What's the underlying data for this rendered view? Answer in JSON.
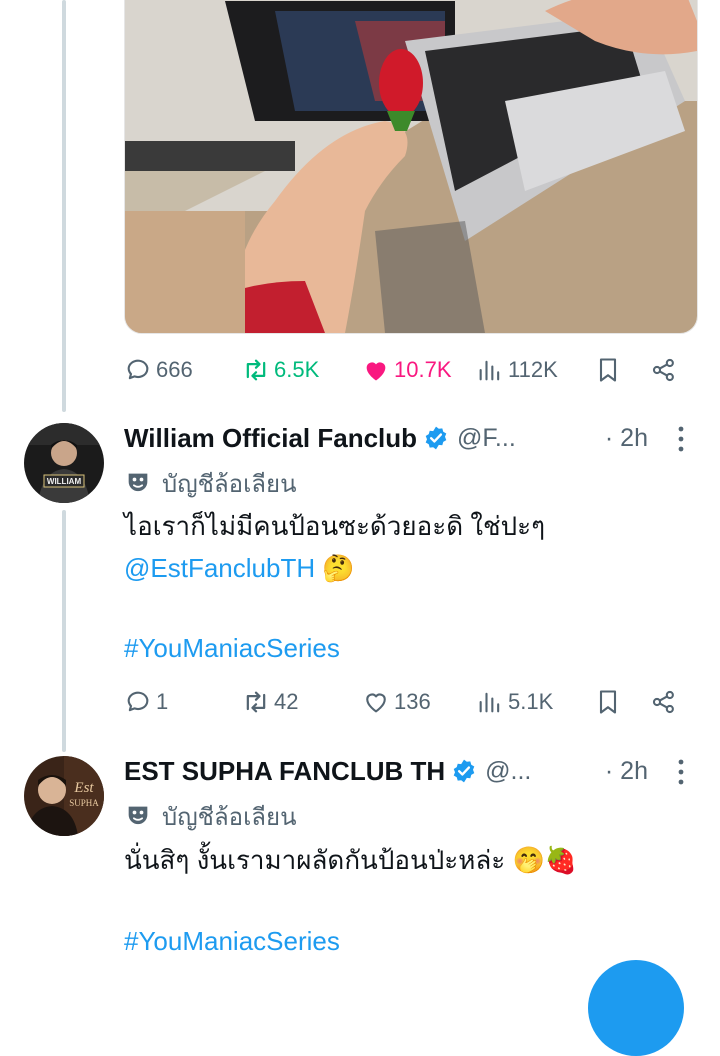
{
  "first_tweet": {
    "actions": {
      "replies": "666",
      "retweets": "6.5K",
      "likes": "10.7K",
      "views": "112K"
    }
  },
  "tweets": [
    {
      "name": "William Official Fanclub",
      "handle": "@F...",
      "time": "· 2h",
      "parody_label": "บัญชีล้อเลียน",
      "line1": "ไอเราก็ไม่มีคนป้อนซะด้วยอะดิ ใช่ปะๆ",
      "mention": "@EstFanclubTH",
      "mention_emoji": "🤔",
      "hashtag": "#YouManiacSeries",
      "actions": {
        "replies": "1",
        "retweets": "42",
        "likes": "136",
        "views": "5.1K"
      },
      "avatar_text": "WILLIAM"
    },
    {
      "name": "EST SUPHA FANCLUB TH",
      "handle": "@...",
      "time": "· 2h",
      "parody_label": "บัญชีล้อเลียน",
      "line1": "นั่นสิๆ งั้นเรามาผลัดกันป้อนป่ะหล่ะ",
      "line1_emoji": "🤭🍓",
      "hashtag": "#YouManiacSeries",
      "avatar_text": "Est",
      "avatar_subtext": "SUPHA"
    }
  ],
  "colors": {
    "accent": "#1d9bf0",
    "retweet": "#00ba7c",
    "like": "#f91880",
    "muted": "#536471",
    "text": "#0f1419"
  }
}
